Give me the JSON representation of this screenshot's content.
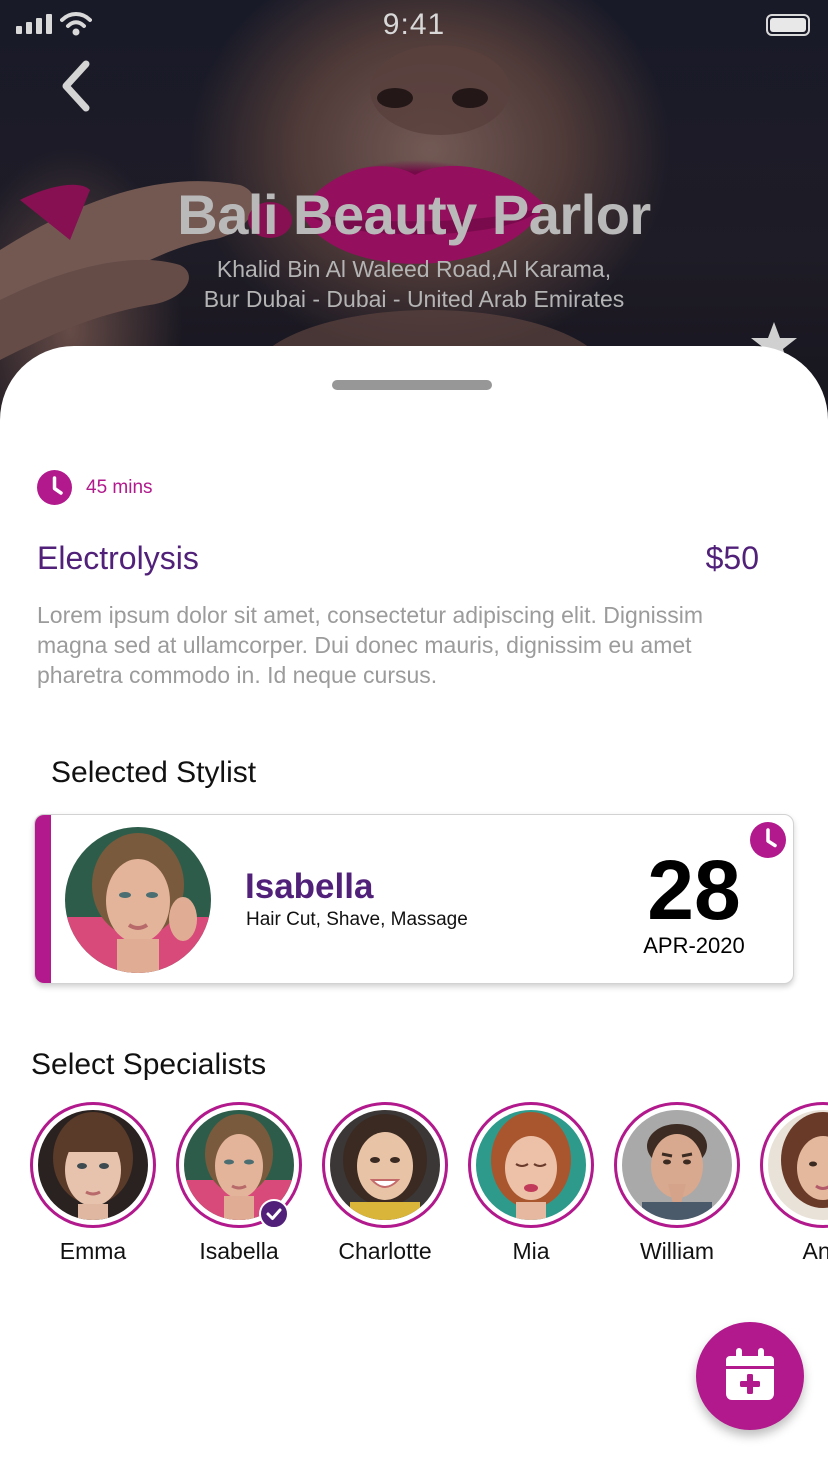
{
  "status_bar": {
    "time": "9:41"
  },
  "salon": {
    "name": "Bali Beauty Parlor",
    "address_line1": "Khalid Bin Al Waleed Road,Al Karama,",
    "address_line2": "Bur Dubai - Dubai - United Arab Emirates"
  },
  "service": {
    "duration": "45 mins",
    "name": "Electrolysis",
    "price": "$50",
    "description": "Lorem ipsum dolor sit amet, consectetur adipiscing elit. Dignissim magna sed at ullamcorper. Dui donec mauris, dignissim eu amet pharetra commodo in. Id neque cursus."
  },
  "selected_stylist": {
    "section_title": "Selected Stylist",
    "name": "Isabella",
    "services": "Hair Cut,  Shave, Massage",
    "day": "28",
    "month_year": "APR-2020"
  },
  "specialists": {
    "section_title": "Select Specialists",
    "items": [
      {
        "name": "Emma",
        "selected": false
      },
      {
        "name": "Isabella",
        "selected": true
      },
      {
        "name": "Charlotte",
        "selected": false
      },
      {
        "name": "Mia",
        "selected": false
      },
      {
        "name": "William",
        "selected": false
      },
      {
        "name": "Ana",
        "selected": false
      }
    ]
  },
  "colors": {
    "accent": "#b1198c",
    "primary": "#51217a",
    "muted_text": "#9b9b9b"
  },
  "icons": {
    "back": "chevron-left-icon",
    "favorite": "star-icon",
    "duration": "clock-icon",
    "selected": "check-icon",
    "fab": "calendar-plus-icon"
  }
}
